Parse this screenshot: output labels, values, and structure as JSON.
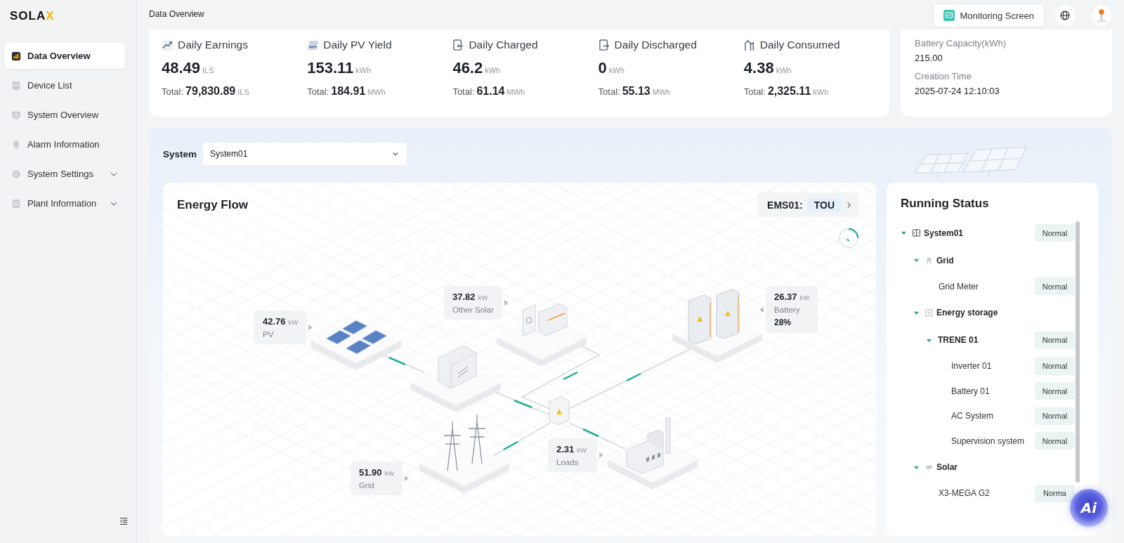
{
  "sidebar": {
    "logo": {
      "text": "SOLA",
      "accent": "X"
    },
    "items": [
      {
        "label": "Data Overview",
        "kind": "chart",
        "selected": true
      },
      {
        "label": "Device List",
        "kind": "device",
        "selected": false
      },
      {
        "label": "System Overview",
        "kind": "monitor",
        "selected": false
      },
      {
        "label": "Alarm Information",
        "kind": "bell",
        "selected": false
      },
      {
        "label": "System Settings",
        "kind": "gear",
        "selected": false,
        "expanded": false
      },
      {
        "label": "Plant Information",
        "kind": "plant",
        "selected": false,
        "expanded": false
      }
    ]
  },
  "header": {
    "breadcrumb": "Data Overview",
    "monitoring_button": "Monitoring Screen"
  },
  "stats": [
    {
      "kind": "earnings",
      "title": "Daily Earnings",
      "value": "48.49",
      "unit": "ILS",
      "total_label": "Total:",
      "total": "79,830.89",
      "total_unit": "ILS"
    },
    {
      "kind": "pv",
      "title": "Daily PV Yield",
      "value": "153.11",
      "unit": "kWh",
      "total_label": "Total:",
      "total": "184.91",
      "total_unit": "MWh"
    },
    {
      "kind": "charged",
      "title": "Daily Charged",
      "value": "46.2",
      "unit": "kWh",
      "total_label": "Total:",
      "total": "61.14",
      "total_unit": "MWh"
    },
    {
      "kind": "discharged",
      "title": "Daily Discharged",
      "value": "0",
      "unit": "kWh",
      "total_label": "Total:",
      "total": "55.13",
      "total_unit": "MWh"
    },
    {
      "kind": "consumed",
      "title": "Daily Consumed",
      "value": "4.38",
      "unit": "kWh",
      "total_label": "Total:",
      "total": "2,325.11",
      "total_unit": "kWh"
    }
  ],
  "info": [
    {
      "label": "Battery Capacity(kWh)",
      "value": "215.00"
    },
    {
      "label": "Creation Time",
      "value": "2025-07-24 12:10:03"
    }
  ],
  "system_select": {
    "label": "System",
    "value": "System01"
  },
  "energy_flow": {
    "title": "Energy Flow",
    "ems_label": "EMS01:",
    "ems_mode": "TOU",
    "nodes": [
      {
        "kind": "pv",
        "value": "42.76",
        "unit": "kW",
        "label": "PV"
      },
      {
        "kind": "other_solar",
        "value": "37.82",
        "unit": "kW",
        "label": "Other Solar"
      },
      {
        "kind": "battery",
        "value": "26.37",
        "unit": "kW",
        "label": "Battery",
        "soc": "28%"
      },
      {
        "kind": "loads",
        "value": "2.31",
        "unit": "kW",
        "label": "Loads"
      },
      {
        "kind": "grid",
        "value": "51.90",
        "unit": "kW",
        "label": "Grid"
      }
    ]
  },
  "running_status": {
    "title": "Running Status",
    "tree": [
      {
        "name": "System01",
        "kind": "system",
        "status": "Normal",
        "expanded": true,
        "children": [
          {
            "name": "Grid",
            "kind": "grid",
            "expanded": true,
            "children": [
              {
                "name": "Grid Meter",
                "status": "Normal"
              }
            ]
          },
          {
            "name": "Energy storage",
            "kind": "storage",
            "expanded": true,
            "children": [
              {
                "name": "TRENE 01",
                "status": "Normal",
                "expanded": true,
                "children": [
                  {
                    "name": "Inverter 01",
                    "status": "Normal"
                  },
                  {
                    "name": "Battery 01",
                    "status": "Normal"
                  },
                  {
                    "name": "AC System",
                    "status": "Normal"
                  },
                  {
                    "name": "Supervision system",
                    "status": "Normal"
                  }
                ]
              }
            ]
          },
          {
            "name": "Solar",
            "kind": "solar",
            "expanded": true,
            "children": [
              {
                "name": "X3-MEGA G2",
                "status": "Norma"
              }
            ]
          }
        ]
      }
    ]
  },
  "ai_button": {
    "label": "Ai"
  }
}
